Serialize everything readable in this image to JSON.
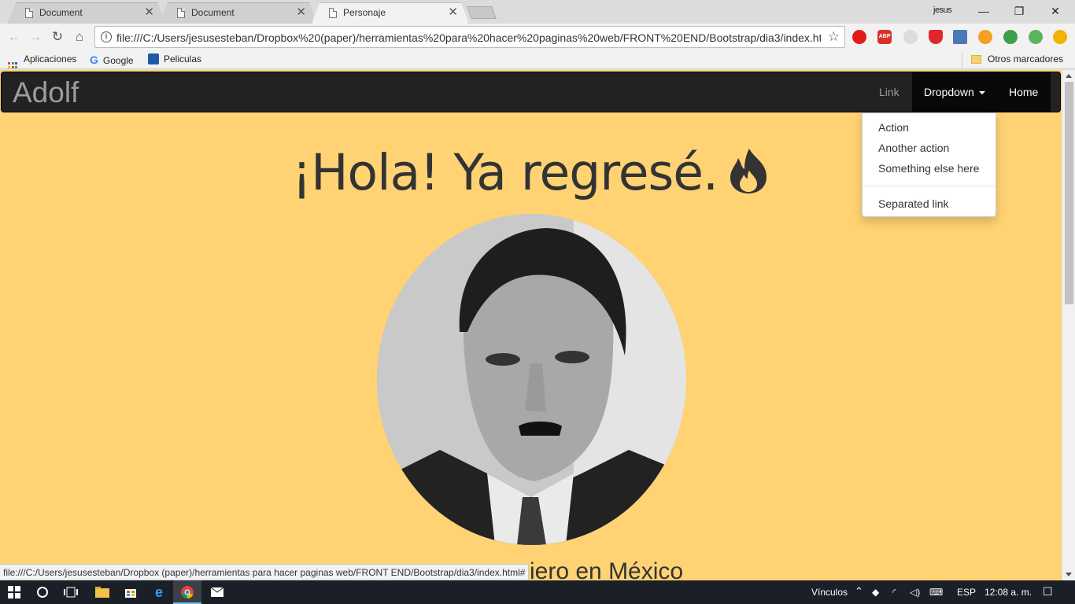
{
  "browser": {
    "tabs": [
      {
        "title": "Document",
        "active": false
      },
      {
        "title": "Document",
        "active": false
      },
      {
        "title": "Personaje",
        "active": true
      }
    ],
    "profile_name": "jesus",
    "url": "file:///C:/Users/jesusesteban/Dropbox%20(paper)/herramientas%20para%20hacer%20paginas%20web/FRONT%20END/Bootstrap/dia3/index.ht...",
    "bookmarks": [
      {
        "label": "Aplicaciones",
        "icon": "apps-grid-icon"
      },
      {
        "label": "Google",
        "icon": "google-icon"
      },
      {
        "label": "Peliculas",
        "icon": "bookmark-favicon-icon"
      }
    ],
    "other_bookmarks": "Otros marcadores",
    "status_url": "file:///C:/Users/jesusesteban/Dropbox (paper)/herramientas para hacer paginas web/FRONT END/Bootstrap/dia3/index.html#"
  },
  "page": {
    "brand": "Adolf",
    "nav": {
      "link": "Link",
      "dropdown": "Dropdown",
      "home": "Home"
    },
    "dropdown_items": [
      "Action",
      "Another action",
      "Something else here"
    ],
    "dropdown_separated": "Separated link",
    "hero_title": "¡Hola! Ya regresé.",
    "subtitle_partial": "iero en México"
  },
  "taskbar": {
    "tray_label": "Vínculos",
    "language": "ESP",
    "time": "12:08 a. m."
  },
  "colors": {
    "page_background": "#ffd374",
    "navbar": "#222222",
    "navbar_active": "#080808"
  }
}
